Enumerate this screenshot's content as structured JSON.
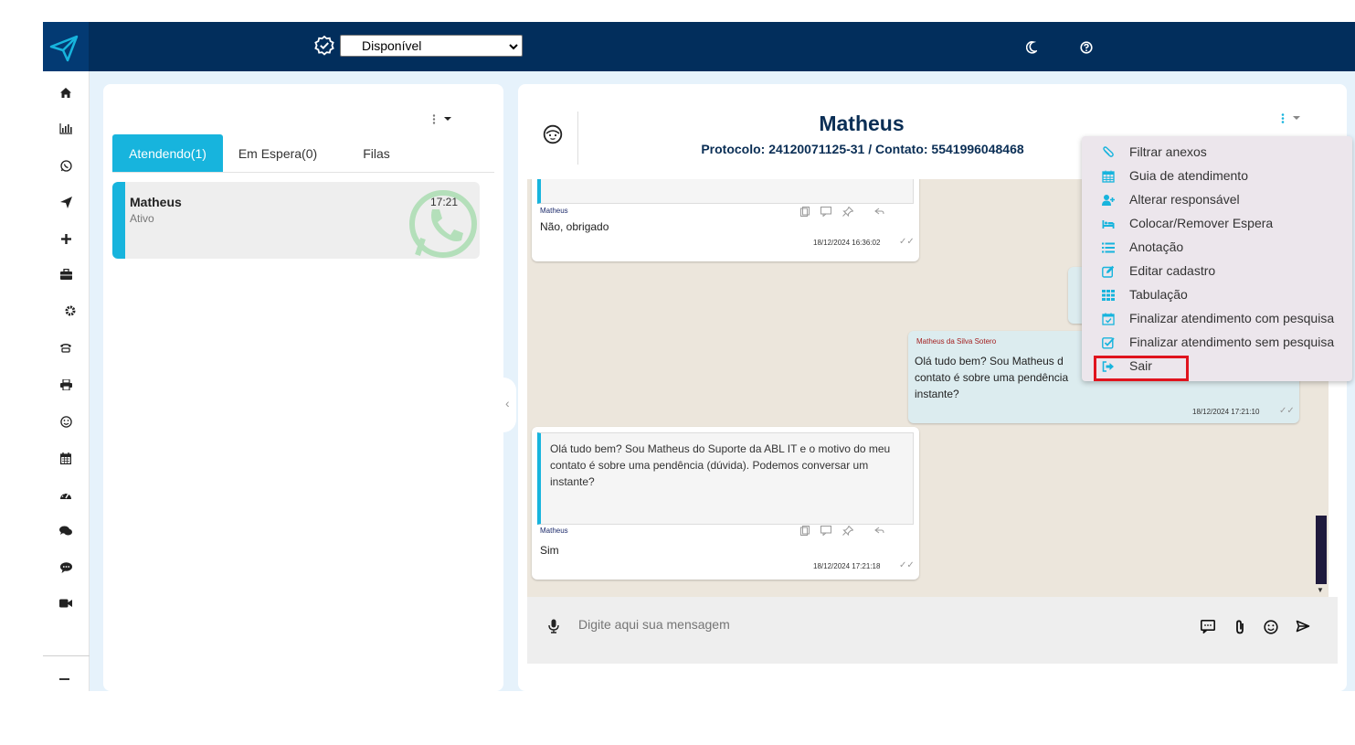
{
  "header": {
    "status_value": "Disponível",
    "status_options": [
      "Disponível"
    ]
  },
  "sidebar": {
    "icons": [
      "home-icon",
      "chart-icon",
      "whatsapp-icon",
      "send-icon",
      "plus-icon",
      "briefcase-icon",
      "gear-icon",
      "phone-icon",
      "printer-icon",
      "smile-icon",
      "calendar-icon",
      "dashboard-icon",
      "comments-icon",
      "comment-icon",
      "video-icon"
    ]
  },
  "tabs": {
    "attending": "Atendendo(1)",
    "waiting": "Em Espera(0)",
    "queues": "Filas"
  },
  "contact": {
    "name": "Matheus",
    "status": "Ativo",
    "time": "17:21"
  },
  "chat": {
    "title": "Matheus",
    "protocol": "Protocolo: 24120071125-31 / Contato: 5541996048468",
    "messages": [
      {
        "sender": "Matheus",
        "text": "Não, obrigado",
        "timestamp": "18/12/2024 16:36:02"
      },
      {
        "sender": "Matheus da Silva Sotero",
        "text": "Olá tudo bem? Sou Matheus  d contato é sobre uma pendência instante?",
        "timestamp": "18/12/2024 17:21:10"
      },
      {
        "quote": "Olá tudo bem? Sou Matheus  do Suporte da ABL IT e o motivo do meu contato é sobre uma pendência (dúvida). Podemos conversar um instante?",
        "sender": "Matheus",
        "text": "Sim",
        "timestamp": "18/12/2024 17:21:18"
      }
    ],
    "input_placeholder": "Digite aqui sua mensagem"
  },
  "menu": {
    "items": [
      {
        "label": "Filtrar anexos",
        "icon": "paperclip-icon"
      },
      {
        "label": "Guia de atendimento",
        "icon": "calendar-icon"
      },
      {
        "label": "Alterar responsável",
        "icon": "user-plus-icon"
      },
      {
        "label": "Colocar/Remover Espera",
        "icon": "bed-icon"
      },
      {
        "label": "Anotação",
        "icon": "list-icon"
      },
      {
        "label": "Editar cadastro",
        "icon": "edit-icon"
      },
      {
        "label": "Tabulação",
        "icon": "grid-icon"
      },
      {
        "label": "Finalizar atendimento com pesquisa",
        "icon": "calendar-check-icon"
      },
      {
        "label": "Finalizar atendimento sem pesquisa",
        "icon": "check-square-icon"
      },
      {
        "label": "Sair",
        "icon": "sign-out-icon"
      }
    ]
  },
  "colors": {
    "header": "#022e5c",
    "accent": "#17b4dd",
    "highlight": "#e0141e"
  }
}
